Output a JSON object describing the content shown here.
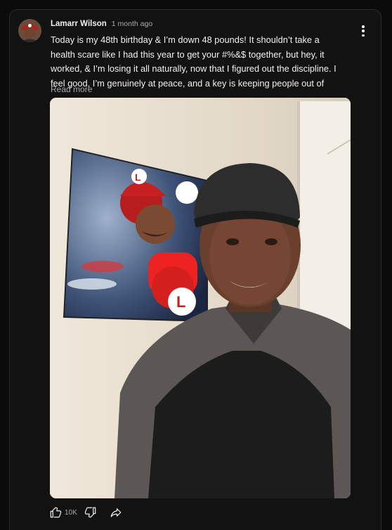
{
  "post": {
    "author": "Lamarr Wilson",
    "time": "1 month ago",
    "text": "Today is my 48th birthday & I’m down 48 pounds! It shouldn’t take a health scare like I had this year to get your #%&$ together, but hey, it worked, & I’m losing it all naturally, now that I figured out the discipline. I feel good, I’m genuinely at peace, and a key is keeping people out of m…",
    "read_more": "Read more",
    "like_count": "10K"
  },
  "icons": {
    "menu": "more-vert-icon",
    "like": "thumb-up-icon",
    "dislike": "thumb-down-icon",
    "share": "share-icon"
  },
  "colors": {
    "background": "#0b0b0b",
    "card": "#121212",
    "text": "#f1f1f1",
    "secondary_text": "#aaaaaa"
  }
}
